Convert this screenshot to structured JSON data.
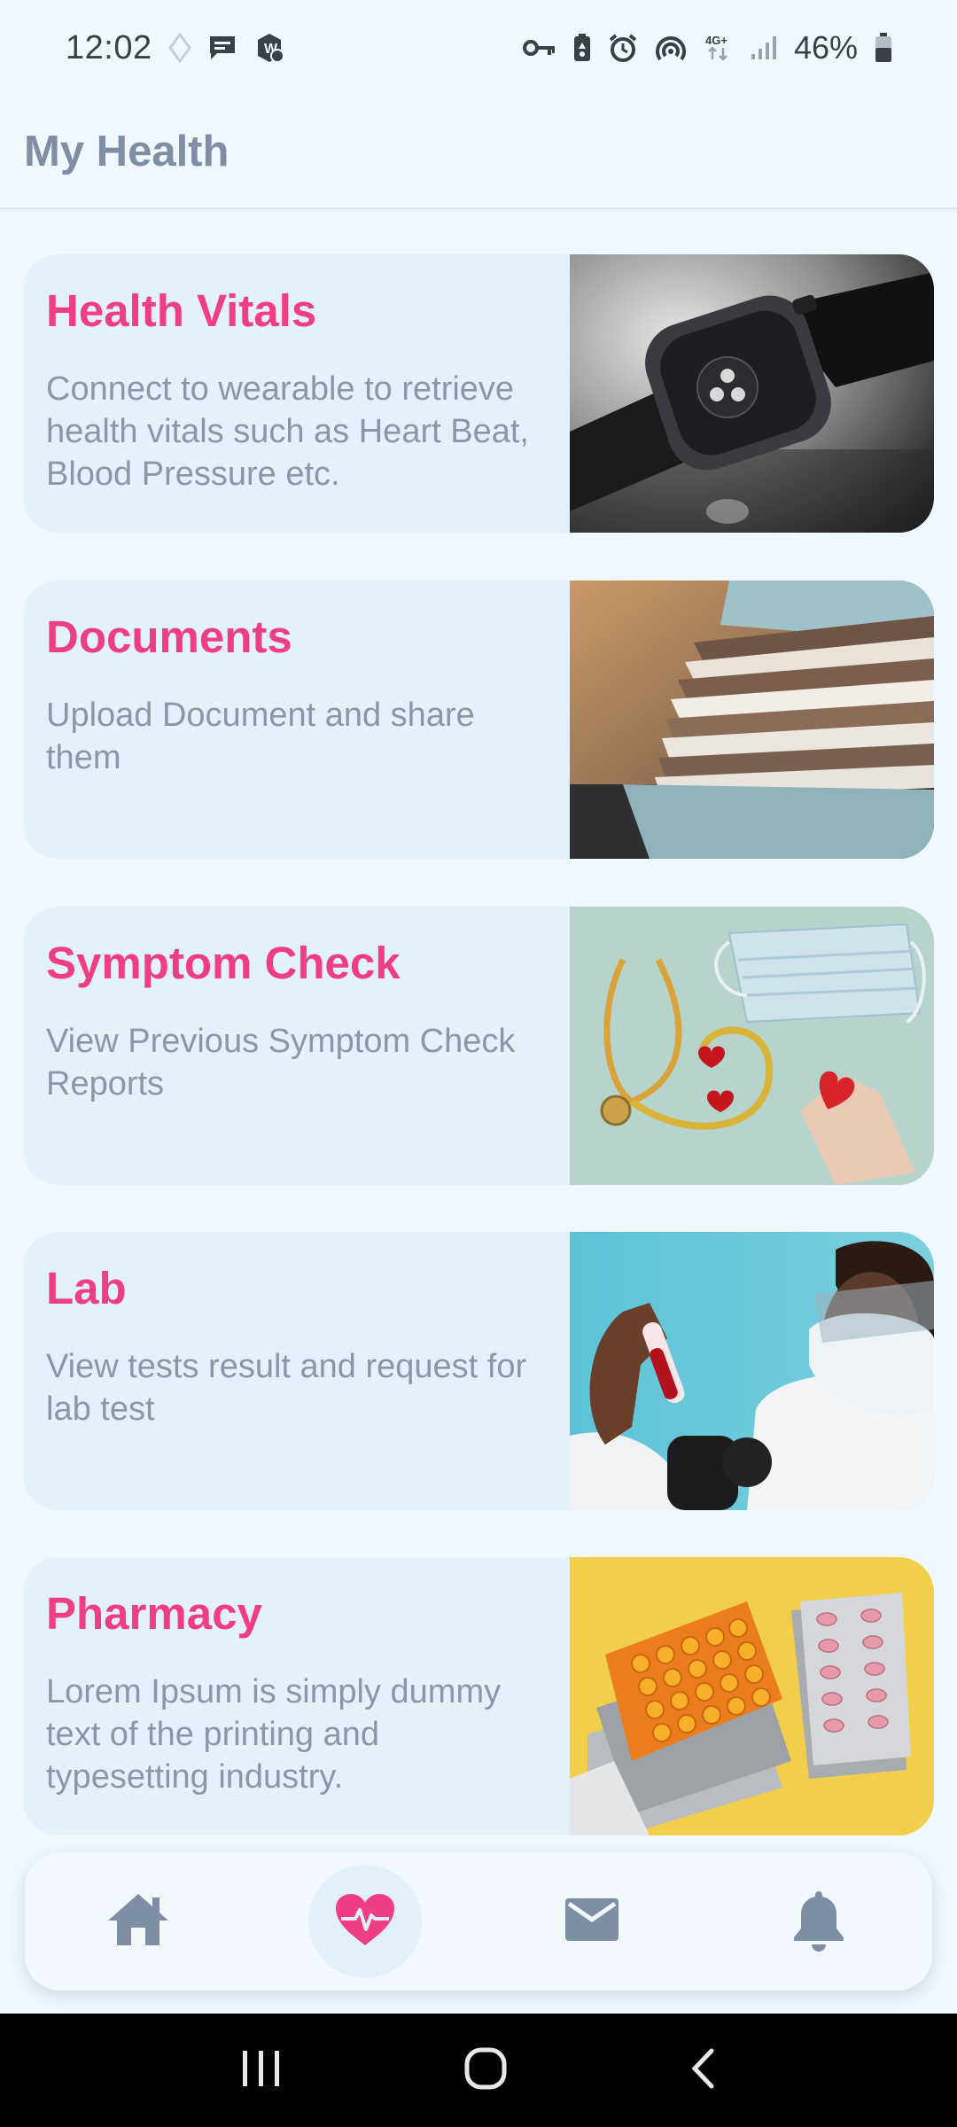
{
  "status_bar": {
    "time": "12:02",
    "battery": "46%",
    "network": "4G+"
  },
  "header": {
    "title": "My Health"
  },
  "cards": [
    {
      "title": "Health Vitals",
      "description": "Connect to wearable to retrieve health vitals such as Heart Beat, Blood Pressure etc.",
      "image": "smartwatch-photo"
    },
    {
      "title": "Documents",
      "description": "Upload Document and share them",
      "image": "file-folders-photo"
    },
    {
      "title": "Symptom Check",
      "description": "View Previous Symptom Check Reports",
      "image": "stethoscope-mask-photo"
    },
    {
      "title": "Lab",
      "description": "View tests result and request for lab test",
      "image": "lab-scientist-photo"
    },
    {
      "title": "Pharmacy",
      "description": "Lorem Ipsum is simply dummy text of the printing and typesetting industry.",
      "image": "pill-blister-packs-photo"
    }
  ],
  "bottom_nav": {
    "items": [
      {
        "icon": "home-icon",
        "active": false
      },
      {
        "icon": "heart-pulse-icon",
        "active": true
      },
      {
        "icon": "mail-icon",
        "active": false
      },
      {
        "icon": "bell-icon",
        "active": false
      }
    ]
  },
  "colors": {
    "background": "#f0f7fd",
    "card_background": "#e3f1fb",
    "title_accent": "#ef3f82",
    "muted_text": "#8a97a8",
    "header_title": "#7d8ea5",
    "nav_icon": "#7d8ea5"
  }
}
